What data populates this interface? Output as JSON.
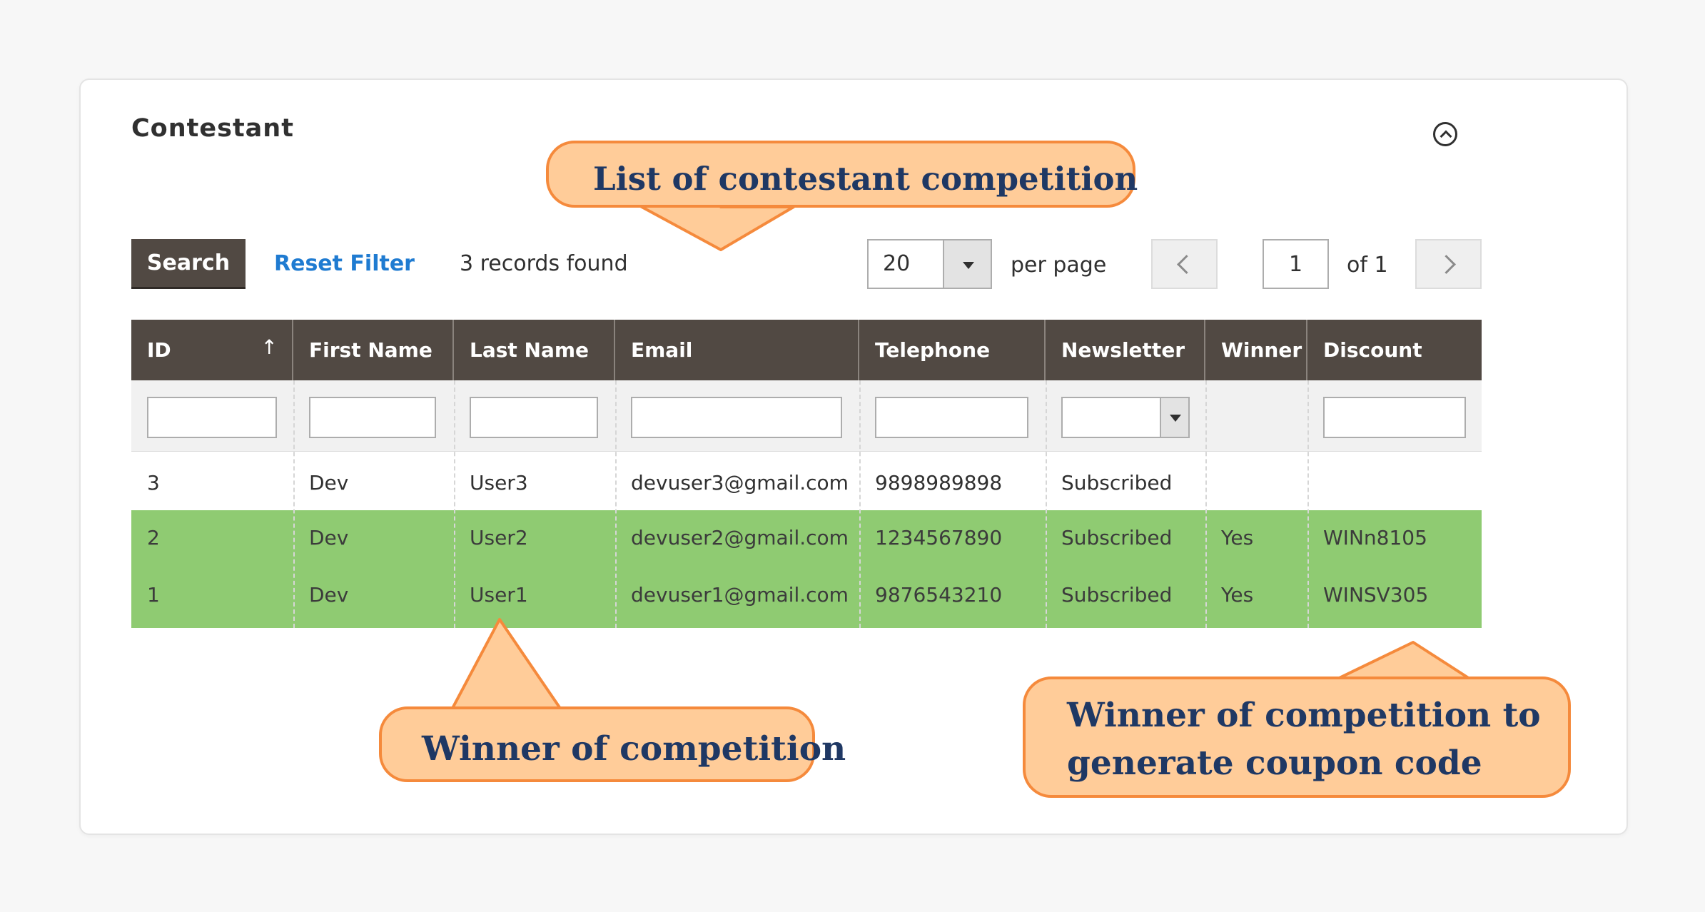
{
  "section": {
    "title": "Contestant"
  },
  "toolbar": {
    "search_label": "Search",
    "reset_label": "Reset Filter",
    "records_found": "3 records found",
    "per_page_value": "20",
    "per_page_label": "per page",
    "current_page": "1",
    "of_pages": "of 1"
  },
  "grid": {
    "columns": [
      "ID",
      "First Name",
      "Last Name",
      "Email",
      "Telephone",
      "Newsletter",
      "Winner",
      "Discount Code"
    ],
    "sort_indicator": "↑",
    "rows": [
      {
        "id": "3",
        "first_name": "Dev",
        "last_name": "User3",
        "email": "devuser3@gmail.com",
        "telephone": "9898989898",
        "newsletter": "Subscribed",
        "winner": "",
        "discount_code": "",
        "highlight": false
      },
      {
        "id": "2",
        "first_name": "Dev",
        "last_name": "User2",
        "email": "devuser2@gmail.com",
        "telephone": "1234567890",
        "newsletter": "Subscribed",
        "winner": "Yes",
        "discount_code": "WINn8105",
        "highlight": true
      },
      {
        "id": "1",
        "first_name": "Dev",
        "last_name": "User1",
        "email": "devuser1@gmail.com",
        "telephone": "9876543210",
        "newsletter": "Subscribed",
        "winner": "Yes",
        "discount_code": "WINSV305",
        "highlight": true
      }
    ]
  },
  "callouts": {
    "list": "List of contestant competition",
    "winner": "Winner of competition",
    "coupon_line1": "Winner of competition to",
    "coupon_line2": "generate coupon code"
  },
  "colors": {
    "header_bg": "#514943",
    "winner_row_bg": "#8fcb72",
    "link": "#1f7bd1",
    "callout_fill": "#ffcc99",
    "callout_border": "#f58a3c",
    "callout_text": "#1f3864"
  },
  "icons": {
    "collapse": "chevron-up-circle-icon",
    "per_page_dropdown": "caret-down-icon",
    "prev": "chevron-left-icon",
    "next": "chevron-right-icon",
    "sort": "sort-ascending-icon"
  }
}
